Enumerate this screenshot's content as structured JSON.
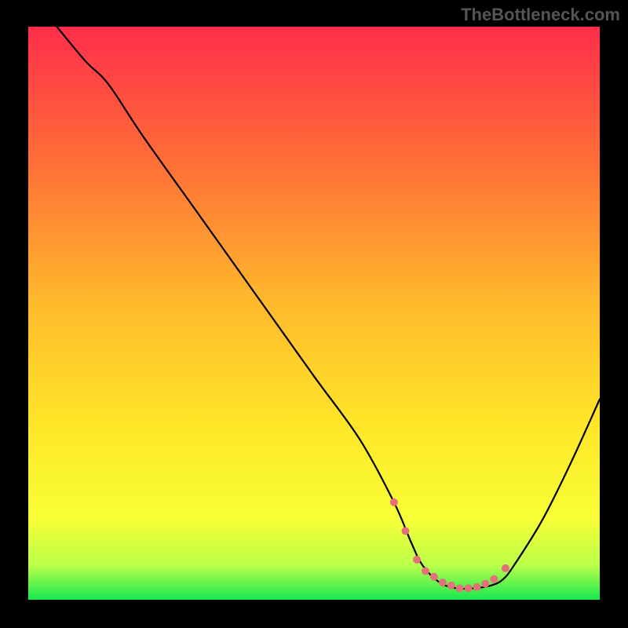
{
  "watermark": "TheBottleneck.com",
  "chart_data": {
    "type": "line",
    "title": "",
    "xlabel": "",
    "ylabel": "",
    "xlim": [
      0,
      100
    ],
    "ylim": [
      0,
      100
    ],
    "axes_visible": false,
    "grid": false,
    "legend": false,
    "background_gradient_colors": [
      "#ff2d4b",
      "#ff6a38",
      "#ffb92c",
      "#ffe728",
      "#f7ff37",
      "#baff4a",
      "#17e84f"
    ],
    "series": [
      {
        "name": "bottleneck-curve",
        "stroke": "#000000",
        "stroke_width": 2.2,
        "x": [
          5,
          10,
          14,
          20,
          30,
          40,
          50,
          58,
          64,
          67,
          69,
          72,
          75,
          78,
          81,
          83,
          85,
          90,
          95,
          100
        ],
        "values": [
          100,
          94,
          90,
          81,
          67,
          53,
          39,
          28,
          17,
          10,
          6,
          3,
          2,
          2,
          2.5,
          3.5,
          6,
          14,
          24,
          35
        ]
      }
    ],
    "markers": {
      "name": "optimal-range-dots",
      "color": "#e4707a",
      "radius": 5,
      "x": [
        64,
        66,
        68,
        69.5,
        71,
        72.5,
        74,
        75.5,
        77,
        78.5,
        80,
        81.5,
        83.5
      ],
      "values": [
        17,
        12,
        7,
        5,
        4,
        3,
        2.5,
        2,
        2,
        2.2,
        2.8,
        3.6,
        5.5
      ]
    }
  }
}
